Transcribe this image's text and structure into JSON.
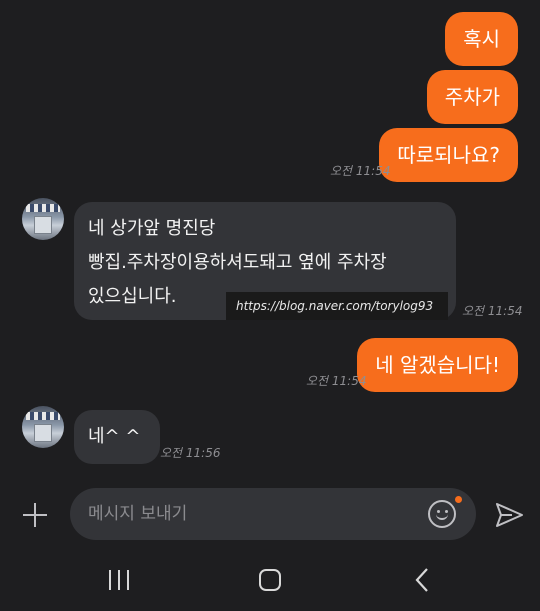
{
  "messages": {
    "out1": "혹시",
    "out2": "주차가",
    "out3": "따로되나요?",
    "out3_time": "오전 11:54",
    "in1_lines": [
      "네 상가앞 명진당",
      "빵집.주차장이용하셔도돼고 옆에 주차장",
      "있으십니다."
    ],
    "in1_time": "오전 11:54",
    "watermark": "https://blog.naver.com/torylog93",
    "out4": "네 알겠습니다!",
    "out4_time": "오전 11:54",
    "in2": "네^ ^",
    "in2_time": "오전 11:56"
  },
  "input": {
    "placeholder": "메시지 보내기",
    "value": ""
  },
  "icons": {
    "attach": "plus-icon",
    "emoji": "emoji-icon",
    "send": "send-icon",
    "nav_recents": "recents-icon",
    "nav_home": "home-icon",
    "nav_back": "back-icon"
  },
  "colors": {
    "background": "#1e1e20",
    "outgoing_bubble": "#f76d1c",
    "incoming_bubble": "#333438",
    "timestamp": "#8e8e92"
  }
}
